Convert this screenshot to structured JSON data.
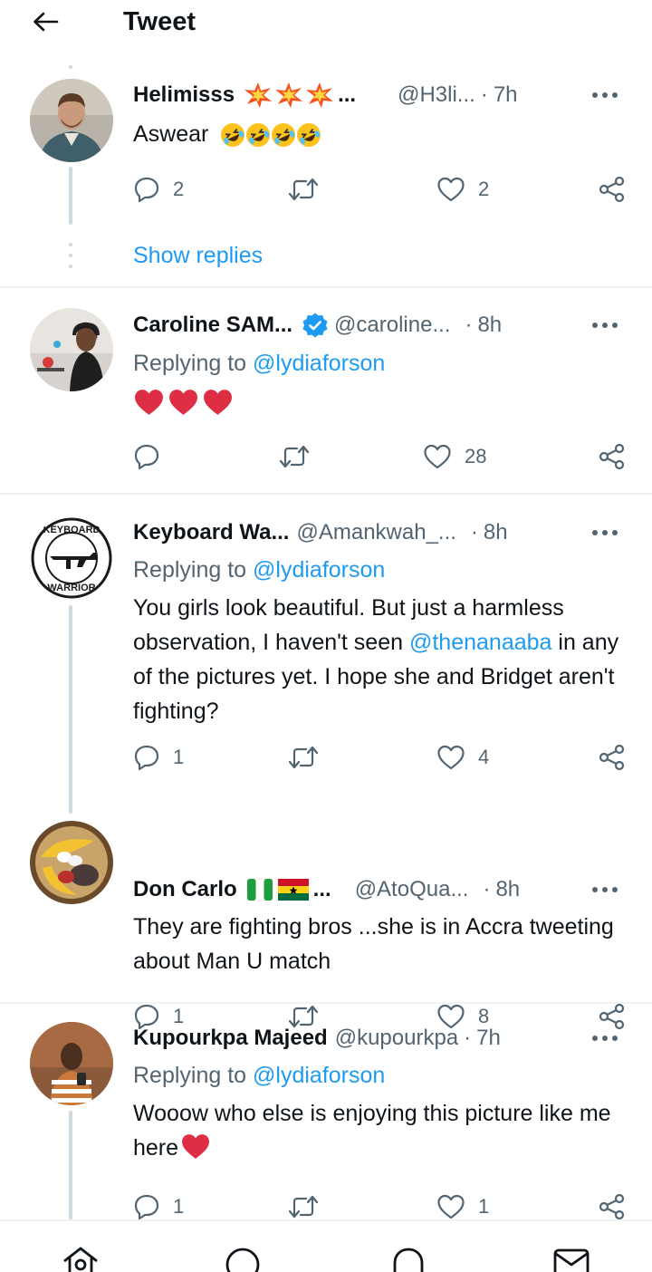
{
  "header": {
    "title": "Tweet"
  },
  "tweets": [
    {
      "display_name": "Helimisss",
      "name_suffix": "...",
      "handle": "@H3li...",
      "time": "7h",
      "text": "Aswear",
      "reply_count": "2",
      "retweet_count": "",
      "like_count": "2"
    },
    {
      "display_name": "Caroline SAM...",
      "handle": "@caroline...",
      "time": "8h",
      "replying_label": "Replying to",
      "replying_handle": "@lydiaforson",
      "reply_count": "",
      "retweet_count": "",
      "like_count": "28"
    },
    {
      "display_name": "Keyboard Wa...",
      "handle": "@Amankwah_...",
      "time": "8h",
      "replying_label": "Replying to",
      "replying_handle": "@lydiaforson",
      "text_1": "You girls look beautiful. But just a harmless observation, I haven't seen",
      "mention": "@thenanaaba",
      "text_2": "in any of the pictures yet. I hope she and Bridget aren't fighting?",
      "reply_count": "1",
      "retweet_count": "",
      "like_count": "4",
      "avatar_text_top": "KEYBOARD",
      "avatar_text_bottom": "WARRIOR"
    },
    {
      "display_name": "Don Carlo",
      "name_suffix": "...",
      "handle": "@AtoQua...",
      "time": "8h",
      "text": "They are fighting bros ...she is in Accra tweeting about Man U match",
      "reply_count": "1",
      "retweet_count": "",
      "like_count": "8"
    },
    {
      "display_name": "Kupourkpa Majeed",
      "handle": "@kupourkpa",
      "time": "7h",
      "replying_label": "Replying to",
      "replying_handle": "@lydiaforson",
      "text": "Wooow who else is enjoying this picture like me here",
      "reply_count": "1",
      "retweet_count": "",
      "like_count": "1"
    }
  ],
  "show_replies_label": "Show replies",
  "tabbar": {
    "items": [
      "home-icon",
      "search-icon",
      "notifications-icon",
      "messages-icon"
    ]
  },
  "colors": {
    "accent": "#1d9bf0",
    "heart": "#e0245e",
    "secondary_text": "#536471",
    "thread_line": "#cfd9de"
  }
}
